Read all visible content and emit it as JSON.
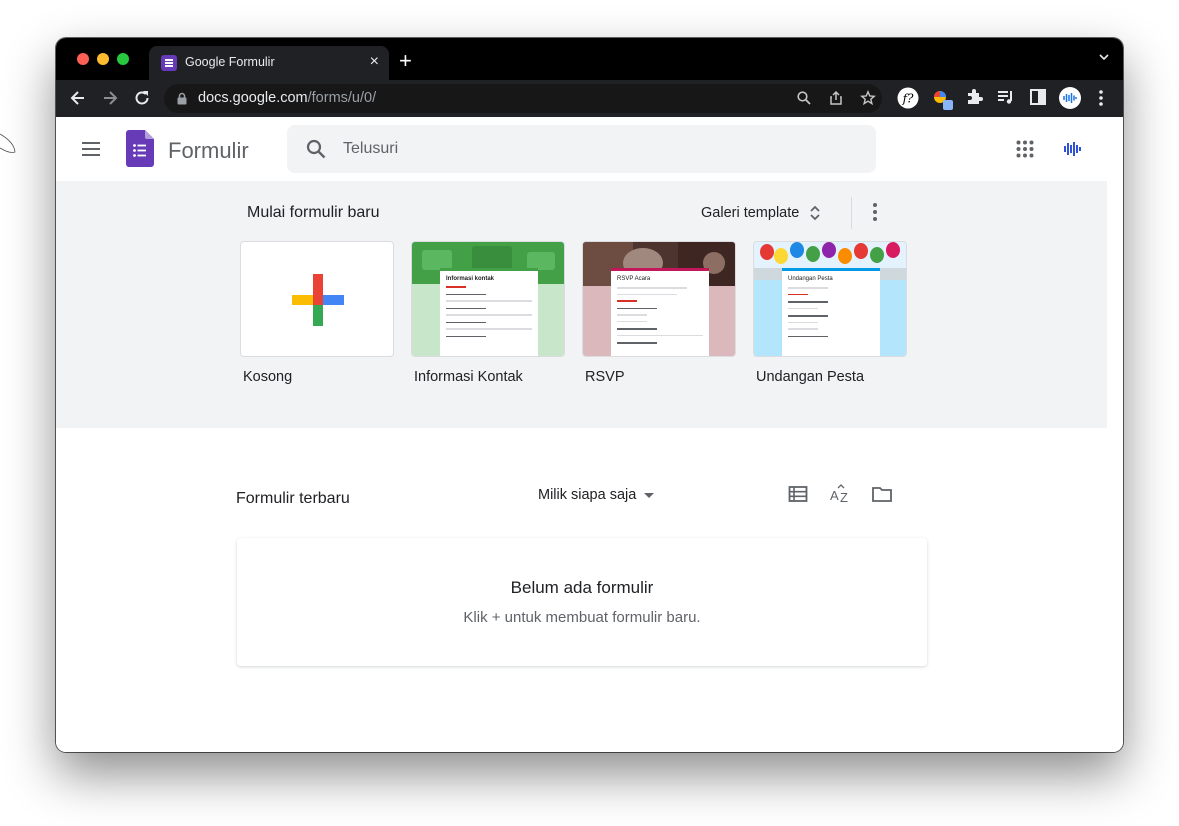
{
  "browser": {
    "tab_title": "Google Formulir",
    "close_glyph": "×",
    "new_tab_glyph": "+",
    "url_host": "docs.google.com",
    "url_path": "/forms/u/0/"
  },
  "app": {
    "brand": "Formulir",
    "search_placeholder": "Telusuri",
    "accent": "#673ab7"
  },
  "gallery": {
    "title": "Mulai formulir baru",
    "template_gallery_label": "Galeri template",
    "templates": [
      {
        "label": "Kosong"
      },
      {
        "label": "Informasi Kontak",
        "doc_title": "Informasi kontak",
        "header_color": "#43a047",
        "body_color": "#c8e6c9"
      },
      {
        "label": "RSVP",
        "doc_title": "RSVP Acara",
        "header_color": "#5d4037",
        "body_color": "#dbb8bc"
      },
      {
        "label": "Undangan Pesta",
        "doc_title": "Undangan Pesta",
        "header_color": "#29b6f6",
        "body_color": "#b3e5fc"
      }
    ]
  },
  "recent": {
    "title": "Formulir terbaru",
    "owner_filter": "Milik siapa saja",
    "empty_title": "Belum ada formulir",
    "empty_subtitle": "Klik + untuk membuat formulir baru."
  }
}
